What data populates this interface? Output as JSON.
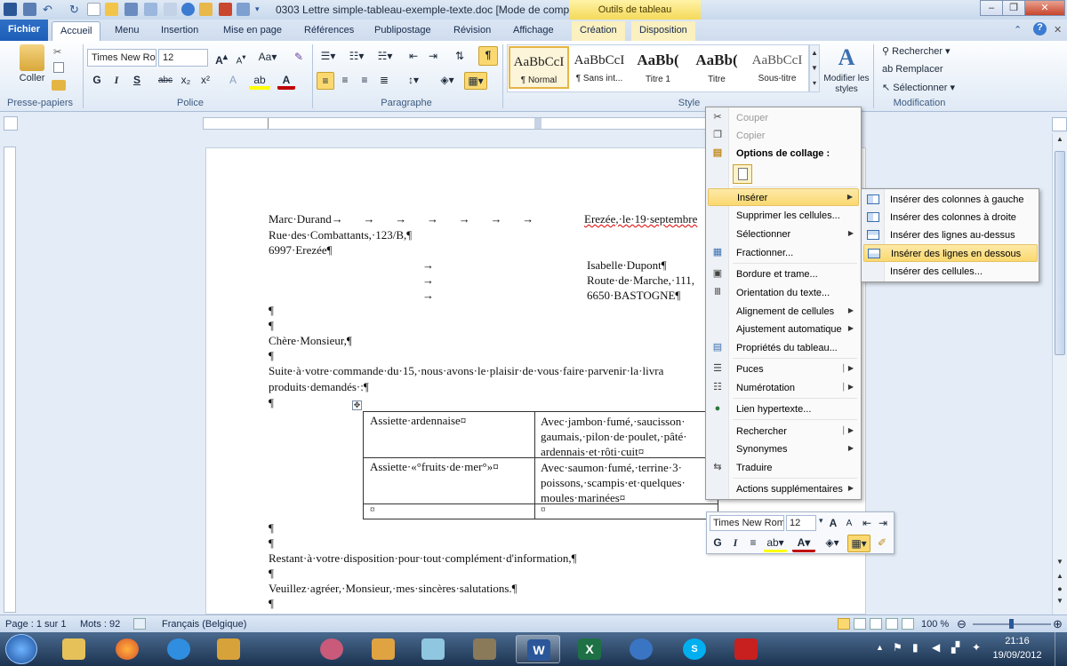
{
  "window": {
    "title": "0303 Lettre simple-tableau-exemple-texte.doc [Mode de comp...",
    "context_tab": "Outils de tableau",
    "minimize": "–",
    "restore": "❐",
    "close": "✕"
  },
  "tabs": [
    "Fichier",
    "Accueil",
    "Menu",
    "Insertion",
    "Mise en page",
    "Références",
    "Publipostage",
    "Révision",
    "Affichage",
    "Création",
    "Disposition"
  ],
  "ribbon": {
    "clipboard": {
      "paste": "Coller",
      "label": "Presse-papiers"
    },
    "font": {
      "name": "Times New Ro",
      "size": "12",
      "label": "Police",
      "bold": "G",
      "italic": "I",
      "underline": "S",
      "strike": "abc",
      "sub": "x₂",
      "sup": "x²"
    },
    "paragraph": {
      "label": "Paragraphe",
      "pilcrow": "¶"
    },
    "styles": {
      "label": "Style",
      "items": [
        {
          "sample": "AaBbCcI",
          "name": "¶ Normal"
        },
        {
          "sample": "AaBbCcI",
          "name": "¶ Sans int..."
        },
        {
          "sample": "AaBb(",
          "name": "Titre 1"
        },
        {
          "sample": "AaBb(",
          "name": "Titre"
        },
        {
          "sample": "AaBbCcI",
          "name": "Sous-titre"
        }
      ],
      "modify": "Modifier les styles"
    },
    "editing": {
      "label": "Modification",
      "find": "Rechercher",
      "replace": "Remplacer",
      "select": "Sélectionner"
    }
  },
  "document": {
    "sender": [
      "Marc·Durand",
      "Rue·des·Combattants,·123/B,¶",
      "6997·Erezée¶"
    ],
    "date": "Erezée,·le·19·septembre",
    "recipient": [
      "Isabelle·Dupont¶",
      "Route·de·Marche,·111,",
      "6650·BASTOGNE¶"
    ],
    "salutation": "Chère·Monsieur,¶",
    "body": [
      "Suite·à·votre·commande·du·15,·nous·avons·le·plaisir·de·vous·faire·parvenir·la·livra",
      "produits·demandés·:¶"
    ],
    "table": [
      [
        "Assiette·ardennaise¤",
        "Avec·jambon·fumé,·saucisson·|gaumais,·pilon·de·poulet,·pâté·|ardennais·et·rôti·cuit¤"
      ],
      [
        "Assiette·«°fruits·de·mer°»¤",
        "Avec·saumon·fumé,·terrine·3·|poissons,·scampis·et·quelques·|moules·marinées¤"
      ],
      [
        "¤",
        "¤"
      ]
    ],
    "closing": [
      "Restant·à·votre·disposition·pour·tout·complément·d'information,¶",
      "Veuillez·agréer,·Monsieur,·mes·sincères·salutations.¶"
    ],
    "pilcrow": "¶"
  },
  "context_menu": {
    "items": [
      {
        "label": "Couper",
        "disabled": true,
        "icon": "scissors-icon"
      },
      {
        "label": "Copier",
        "disabled": true,
        "icon": "copy-icon"
      },
      {
        "label": "Options de collage :",
        "bold": true,
        "icon": "paste-icon"
      },
      {
        "label": "Insérer",
        "submenu": true,
        "highlighted": true
      },
      {
        "label": "Supprimer les cellules..."
      },
      {
        "label": "Sélectionner",
        "submenu": true
      },
      {
        "label": "Fractionner...",
        "icon": "split-icon"
      },
      {
        "label": "Bordure et trame...",
        "icon": "border-icon"
      },
      {
        "label": "Orientation du texte...",
        "icon": "text-direction-icon"
      },
      {
        "label": "Alignement de cellules",
        "submenu": true
      },
      {
        "label": "Ajustement automatique",
        "submenu": true
      },
      {
        "label": "Propriétés du tableau...",
        "icon": "table-properties-icon"
      },
      {
        "label": "Puces",
        "submenu": true,
        "icon": "bullets-icon"
      },
      {
        "label": "Numérotation",
        "submenu": true,
        "icon": "numbering-icon"
      },
      {
        "label": "Lien hypertexte...",
        "icon": "hyperlink-icon"
      },
      {
        "label": "Rechercher",
        "submenu": true
      },
      {
        "label": "Synonymes",
        "submenu": true
      },
      {
        "label": "Traduire",
        "icon": "translate-icon"
      },
      {
        "label": "Actions supplémentaires",
        "submenu": true
      }
    ]
  },
  "submenu": {
    "items": [
      {
        "label": "Insérer des colonnes à gauche"
      },
      {
        "label": "Insérer des colonnes à droite"
      },
      {
        "label": "Insérer des lignes au-dessus"
      },
      {
        "label": "Insérer des lignes en dessous",
        "highlighted": true
      },
      {
        "label": "Insérer des cellules..."
      }
    ]
  },
  "mini_toolbar": {
    "font": "Times New Rom",
    "size": "12",
    "bold": "G",
    "italic": "I"
  },
  "status": {
    "page": "Page : 1 sur 1",
    "words": "Mots : 92",
    "language": "Français (Belgique)",
    "zoom": "100 %"
  },
  "taskbar": {
    "time": "21:16",
    "date": "19/09/2012"
  },
  "colors": {
    "accent": "#2b579a",
    "highlight": "#fbd970",
    "file_tab": "#1c5fb8"
  }
}
